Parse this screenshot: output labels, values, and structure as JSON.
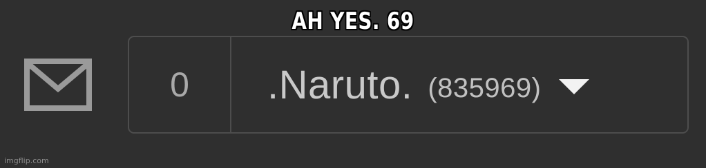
{
  "caption": "AH YES. 69",
  "mail": {
    "icon": "envelope-icon",
    "icon_color": "#9a9a9a"
  },
  "account": {
    "message_count": "0",
    "username": ".Naruto.",
    "points": "(835969)",
    "dropdown_icon": "caret-down-icon"
  },
  "colors": {
    "background": "#2f2f2f",
    "border": "#4d4d4d",
    "text": "#c9c9c9"
  },
  "watermark": "imgflip.com"
}
